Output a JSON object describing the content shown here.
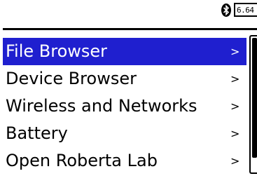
{
  "status_bar": {
    "bluetooth_icon": "bluetooth-icon",
    "battery_voltage": "6.64"
  },
  "menu": {
    "items": [
      {
        "label": "File Browser",
        "arrow": ">",
        "selected": true
      },
      {
        "label": "Device Browser",
        "arrow": ">",
        "selected": false
      },
      {
        "label": "Wireless and Networks",
        "arrow": ">",
        "selected": false
      },
      {
        "label": "Battery",
        "arrow": ">",
        "selected": false
      },
      {
        "label": "Open Roberta Lab",
        "arrow": ">",
        "selected": false
      }
    ]
  },
  "scrollbar": {
    "visible_fraction": 0.9,
    "scroll_position": 0
  },
  "colors": {
    "selection_background": "#1f1fcf",
    "selection_text": "#ffffff",
    "text": "#000000",
    "background": "#ffffff"
  }
}
